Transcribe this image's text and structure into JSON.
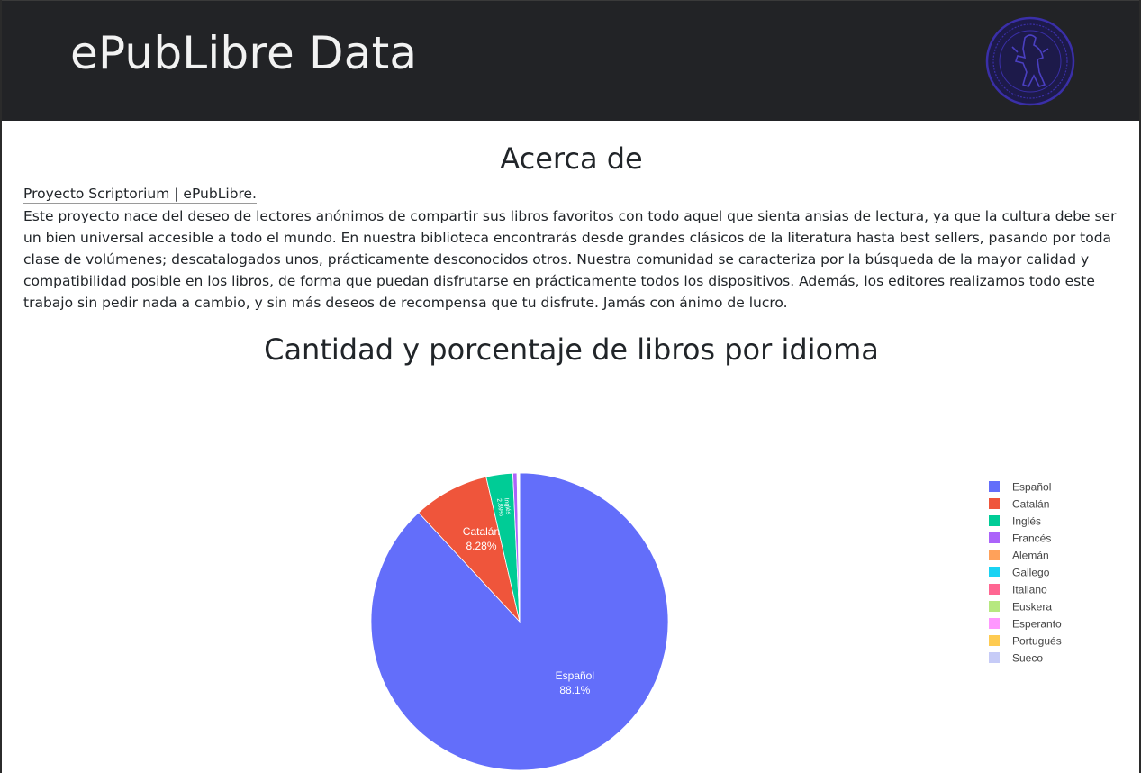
{
  "header": {
    "title": "ePubLibre Data",
    "logo_icon": "seal-logo-icon"
  },
  "about": {
    "title": "Acerca de",
    "link_text": "Proyecto Scriptorium | ePubLibre.",
    "paragraph": "Este proyecto nace del deseo de lectores anónimos de compartir sus libros favoritos con todo aquel que sienta ansias de lectura, ya que la cultura debe ser un bien universal accesible a todo el mundo. En nuestra biblioteca encontrarás desde grandes clásicos de la literatura hasta best sellers, pasando por toda clase de volúmenes; descatalogados unos, prácticamente desconocidos otros. Nuestra comunidad se caracteriza por la búsqueda de la mayor calidad y compatibilidad posible en los libros, de forma que puedan disfrutarse en prácticamente todos los dispositivos. Además, los editores realizamos todo este trabajo sin pedir nada a cambio, y sin más deseos de recompensa que tu disfrute. Jamás con ánimo de lucro."
  },
  "chart_section": {
    "title": "Cantidad y porcentaje de libros por idioma"
  },
  "colors": {
    "header_bg": "#222326",
    "logo": "#3a2fa8"
  },
  "chart_data": {
    "type": "pie",
    "title": "Cantidad y porcentaje de libros por idioma",
    "legend_position": "right",
    "direction": "clockwise",
    "sort": "descending",
    "slices": [
      {
        "label": "Español",
        "percent": 88.1,
        "display": "88.1%",
        "color": "#636efa"
      },
      {
        "label": "Catalán",
        "percent": 8.28,
        "display": "8.28%",
        "color": "#ef553b"
      },
      {
        "label": "Inglés",
        "percent": 2.89,
        "display": "2.89%",
        "color": "#00cc96"
      },
      {
        "label": "Francés",
        "percent": 0.45,
        "display": "",
        "color": "#ab63fa"
      },
      {
        "label": "Alemán",
        "percent": 0.08,
        "display": "",
        "color": "#ffa15a"
      },
      {
        "label": "Gallego",
        "percent": 0.06,
        "display": "",
        "color": "#19d3f3"
      },
      {
        "label": "Italiano",
        "percent": 0.05,
        "display": "",
        "color": "#ff6692"
      },
      {
        "label": "Euskera",
        "percent": 0.04,
        "display": "",
        "color": "#b6e880"
      },
      {
        "label": "Esperanto",
        "percent": 0.02,
        "display": "",
        "color": "#ff97ff"
      },
      {
        "label": "Portugués",
        "percent": 0.02,
        "display": "",
        "color": "#fecb52"
      },
      {
        "label": "Sueco",
        "percent": 0.01,
        "display": "",
        "color": "#c6cbf7"
      }
    ]
  }
}
